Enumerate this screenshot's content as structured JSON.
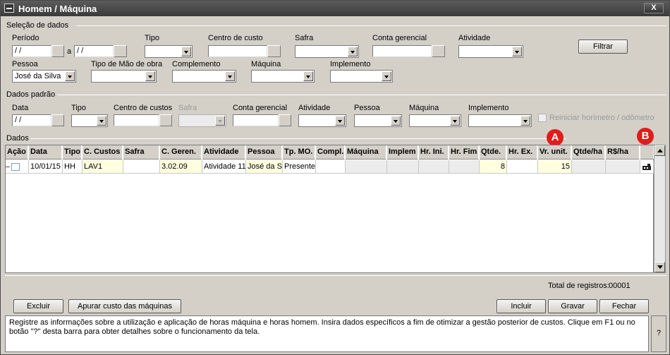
{
  "window": {
    "title": "Homem / Máquina",
    "close_label": "X"
  },
  "selecao": {
    "section_title": "Seleção de dados",
    "periodo_label": "Período",
    "periodo_de": " / /",
    "periodo_sep": "a",
    "periodo_ate": " / /",
    "tipo_label": "Tipo",
    "tipo_value": "",
    "centro_label": "Centro de custo",
    "centro_value": "",
    "safra_label": "Safra",
    "safra_value": "",
    "conta_label": "Conta gerencial",
    "conta_value": "",
    "atividade_label": "Atividade",
    "atividade_value": "",
    "filtrar_label": "Filtrar",
    "pessoa_label": "Pessoa",
    "pessoa_value": "José da Silva",
    "tipo_mao_label": "Tipo de Mão de obra",
    "tipo_mao_value": "",
    "complemento_label": "Complemento",
    "complemento_value": "",
    "maquina_label": "Máquina",
    "maquina_value": "",
    "implemento_label": "Implemento",
    "implemento_value": ""
  },
  "padrao": {
    "section_title": "Dados padrão",
    "data_label": "Data",
    "data_value": " / /",
    "tipo_label": "Tipo",
    "centro_label": "Centro de custos",
    "safra_label": "Safra",
    "conta_label": "Conta gerencial",
    "atividade_label": "Atividade",
    "pessoa_label": "Pessoa",
    "maquina_label": "Máquina",
    "implemento_label": "Implemento",
    "reiniciar_label": "Reiniciar horímetro / odômetro"
  },
  "dados": {
    "section_title": "Dados",
    "badge_a": "A",
    "badge_b": "B",
    "columns": [
      "Ação",
      "Data",
      "Tipo",
      "C. Custos",
      "Safra",
      "C. Geren.",
      "Atividade",
      "Pessoa",
      "Tp. MO.",
      "Compl.",
      "Máquina",
      "Implem",
      "Hr. Ini.",
      "Hr. Fim",
      "Qtde.",
      "Hr. Ex.",
      "Vr. unit.",
      "Qtde/ha",
      "R$/ha",
      ""
    ],
    "row": {
      "data": "10/01/15",
      "tipo": "HH",
      "c_custos": "LAV1",
      "safra": "",
      "c_geren": "3.02.09",
      "atividade": "Atividade 11",
      "pessoa": "José da Si",
      "tp_mo": "Presente",
      "compl": "",
      "maquina": "",
      "implem": "",
      "hr_ini": "",
      "hr_fim": "",
      "qtde": "8",
      "hr_ex": "",
      "vr_unit": "15",
      "qtde_ha": "",
      "rs_ha": ""
    },
    "total_label": "Total de registros:",
    "total_value": "00001"
  },
  "buttons": {
    "excluir": "Excluir",
    "apurar": "Apurar custo das máquinas",
    "incluir": "Incluir",
    "gravar": "Gravar",
    "fechar": "Fechar"
  },
  "help": {
    "text": "Registre as informações sobre a utilização e aplicação de horas máquina e horas homem. Insira dados específicos a fim de otimizar a gestão posterior de custos. Clique em F1 ou no botão \"?\" desta barra para obter detalhes sobre o funcionamento da tela.",
    "q_label": "?"
  },
  "colors": {
    "titlebar": "#3a3a3a",
    "badge": "#e21b1b",
    "highlight_cell": "#ffffe0",
    "window_bg": "#d4d0c8"
  }
}
